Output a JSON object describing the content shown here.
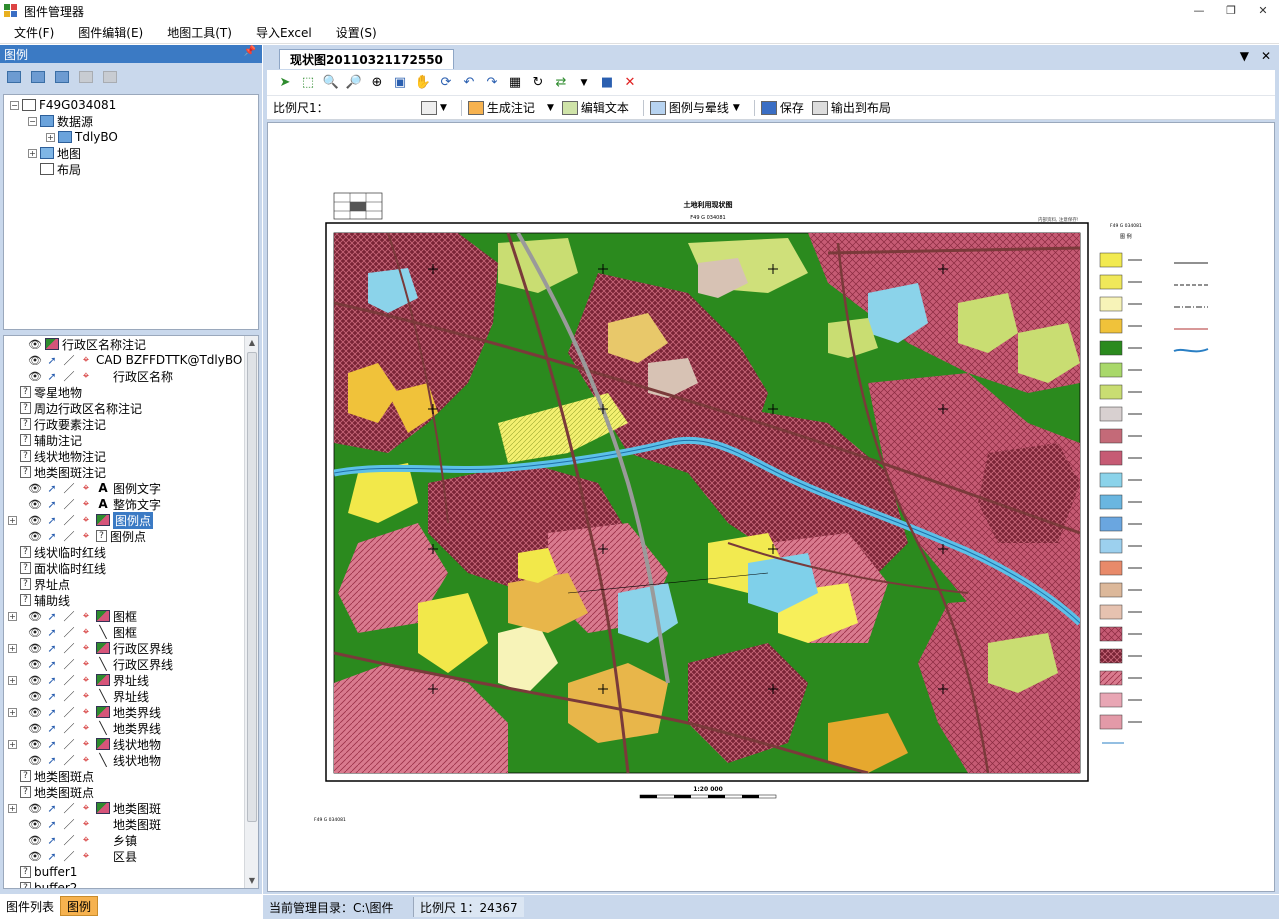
{
  "window": {
    "title": "图件管理器"
  },
  "menu": [
    "文件(F)",
    "图件编辑(E)",
    "地图工具(T)",
    "导入Excel",
    "设置(S)"
  ],
  "left_panel": {
    "header": "图例",
    "pin": "ᵽ",
    "top_tree": [
      {
        "label": "F49G034081",
        "indent": 0,
        "exp": "−",
        "icon": "lay"
      },
      {
        "label": "数据源",
        "indent": 1,
        "exp": "−",
        "icon": "db"
      },
      {
        "label": "TdlyBO",
        "indent": 2,
        "exp": "+",
        "icon": "db"
      },
      {
        "label": "地图",
        "indent": 1,
        "exp": "+",
        "icon": "map"
      },
      {
        "label": "布局",
        "indent": 1,
        "exp": "",
        "icon": "lay"
      }
    ],
    "bottom_tree": [
      {
        "label": "行政区名称注记",
        "indent": 1,
        "kind": "eye-sym"
      },
      {
        "label": "CAD BZFFDTTK@TdlyBO",
        "indent": 1,
        "kind": "full-text"
      },
      {
        "label": "行政区名称",
        "indent": 1,
        "kind": "full-blank"
      },
      {
        "label": "零星地物",
        "indent": 1,
        "kind": "q"
      },
      {
        "label": "周边行政区名称注记",
        "indent": 1,
        "kind": "q"
      },
      {
        "label": "行政要素注记",
        "indent": 1,
        "kind": "q"
      },
      {
        "label": "辅助注记",
        "indent": 1,
        "kind": "q"
      },
      {
        "label": "线状地物注记",
        "indent": 1,
        "kind": "q"
      },
      {
        "label": "地类图斑注记",
        "indent": 1,
        "kind": "q"
      },
      {
        "label": "图例文字",
        "indent": 1,
        "kind": "full-A"
      },
      {
        "label": "整饰文字",
        "indent": 1,
        "kind": "full-A"
      },
      {
        "label": "图例点",
        "indent": 1,
        "kind": "full-sym",
        "exp": "+",
        "selected": true
      },
      {
        "label": "图例点",
        "indent": 1,
        "kind": "full-q"
      },
      {
        "label": "线状临时红线",
        "indent": 1,
        "kind": "q"
      },
      {
        "label": "面状临时红线",
        "indent": 1,
        "kind": "q"
      },
      {
        "label": "界址点",
        "indent": 1,
        "kind": "q"
      },
      {
        "label": "辅助线",
        "indent": 1,
        "kind": "q"
      },
      {
        "label": "图框",
        "indent": 1,
        "kind": "full-sym",
        "exp": "+"
      },
      {
        "label": "图框",
        "indent": 1,
        "kind": "full-ln"
      },
      {
        "label": "行政区界线",
        "indent": 1,
        "kind": "full-sym",
        "exp": "+"
      },
      {
        "label": "行政区界线",
        "indent": 1,
        "kind": "full-ln"
      },
      {
        "label": "界址线",
        "indent": 1,
        "kind": "full-sym",
        "exp": "+"
      },
      {
        "label": "界址线",
        "indent": 1,
        "kind": "full-ln"
      },
      {
        "label": "地类界线",
        "indent": 1,
        "kind": "full-sym",
        "exp": "+"
      },
      {
        "label": "地类界线",
        "indent": 1,
        "kind": "full-ln"
      },
      {
        "label": "线状地物",
        "indent": 1,
        "kind": "full-sym",
        "exp": "+"
      },
      {
        "label": "线状地物",
        "indent": 1,
        "kind": "full-ln"
      },
      {
        "label": "地类图斑点",
        "indent": 1,
        "kind": "q"
      },
      {
        "label": "地类图斑点",
        "indent": 1,
        "kind": "q"
      },
      {
        "label": "地类图斑",
        "indent": 1,
        "kind": "full-sym",
        "exp": "+"
      },
      {
        "label": "地类图斑",
        "indent": 1,
        "kind": "full-blank"
      },
      {
        "label": "乡镇",
        "indent": 1,
        "kind": "full-blank"
      },
      {
        "label": "区县",
        "indent": 1,
        "kind": "full-blank"
      },
      {
        "label": "buffer1",
        "indent": 1,
        "kind": "q"
      },
      {
        "label": "buffer2",
        "indent": 1,
        "kind": "q"
      }
    ],
    "tabs": [
      "图件列表",
      "图例"
    ]
  },
  "document": {
    "tab": "现状图20110321172550",
    "toolbar2": {
      "scale_label": "比例尺1：",
      "buttons": [
        "生成注记",
        "编辑文本",
        "图例与晕线",
        "保存",
        "输出到布局"
      ]
    },
    "map": {
      "title": "土地利用现状图",
      "subtitle": "F49 G 034081",
      "note_right": "内部资料, 注意保存!",
      "sheet_code": "F49 G 034081",
      "legend_title": "图 例",
      "legend_code": "F49 G 034081",
      "scale_text": "1:20 000",
      "bottom_code": "F49 G 034081"
    }
  },
  "status": {
    "directory": "当前管理目录：C:\\图件",
    "scale": "比例尺  1：24367"
  }
}
